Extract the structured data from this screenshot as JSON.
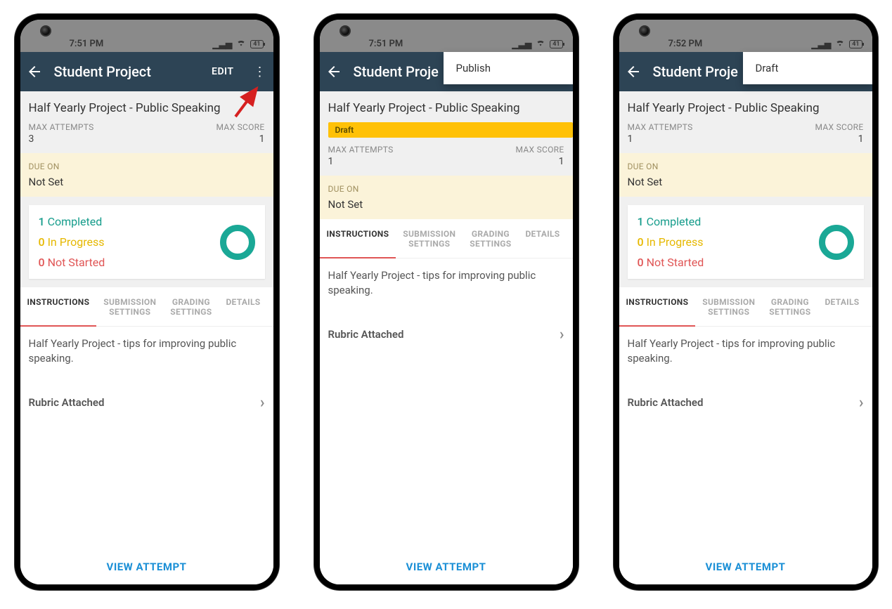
{
  "phones": [
    {
      "time": "7:51 PM",
      "battery": "41",
      "app_title": "Student Project",
      "edit": "EDIT",
      "show_edit": true,
      "popover": null,
      "project_title": "Half Yearly Project - Public Speaking",
      "draft": null,
      "max_attempts_label": "MAX ATTEMPTS",
      "max_attempts": "3",
      "max_score_label": "MAX SCORE",
      "max_score": "1",
      "due_label": "DUE ON",
      "due_value": "Not Set",
      "show_status_card": true,
      "completed_n": "1",
      "completed_t": "Completed",
      "inprogress_n": "0",
      "inprogress_t": "In Progress",
      "notstarted_n": "0",
      "notstarted_t": "Not Started",
      "tabs": [
        "INSTRUCTIONS",
        "SUBMISSION\nSETTINGS",
        "GRADING\nSETTINGS",
        "DETAILS"
      ],
      "instruction": "Half Yearly Project - tips for improving public speaking.",
      "rubric": "Rubric Attached",
      "view_attempt": "VIEW ATTEMPT",
      "show_arrow": true
    },
    {
      "time": "7:51 PM",
      "battery": "41",
      "app_title": "Student Proje",
      "edit": "",
      "show_edit": false,
      "popover": "Publish",
      "project_title": "Half Yearly Project - Public Speaking",
      "draft": "Draft",
      "max_attempts_label": "MAX ATTEMPTS",
      "max_attempts": "1",
      "max_score_label": "MAX SCORE",
      "max_score": "1",
      "due_label": "DUE ON",
      "due_value": "Not Set",
      "show_status_card": false,
      "tabs": [
        "INSTRUCTIONS",
        "SUBMISSION\nSETTINGS",
        "GRADING\nSETTINGS",
        "DETAILS"
      ],
      "instruction": "Half Yearly Project - tips for improving public speaking.",
      "rubric": "Rubric Attached",
      "view_attempt": "VIEW ATTEMPT",
      "show_arrow": false
    },
    {
      "time": "7:52 PM",
      "battery": "41",
      "app_title": "Student Proje",
      "edit": "",
      "show_edit": false,
      "popover": "Draft",
      "project_title": "Half Yearly Project - Public Speaking",
      "draft": null,
      "max_attempts_label": "MAX ATTEMPTS",
      "max_attempts": "1",
      "max_score_label": "MAX SCORE",
      "max_score": "1",
      "due_label": "DUE ON",
      "due_value": "Not Set",
      "show_status_card": true,
      "completed_n": "1",
      "completed_t": "Completed",
      "inprogress_n": "0",
      "inprogress_t": "In Progress",
      "notstarted_n": "0",
      "notstarted_t": "Not Started",
      "tabs": [
        "INSTRUCTIONS",
        "SUBMISSION\nSETTINGS",
        "GRADING\nSETTINGS",
        "DETAILS"
      ],
      "instruction": "Half Yearly Project - tips for improving public speaking.",
      "rubric": "Rubric Attached",
      "view_attempt": "VIEW ATTEMPT",
      "show_arrow": false
    }
  ]
}
